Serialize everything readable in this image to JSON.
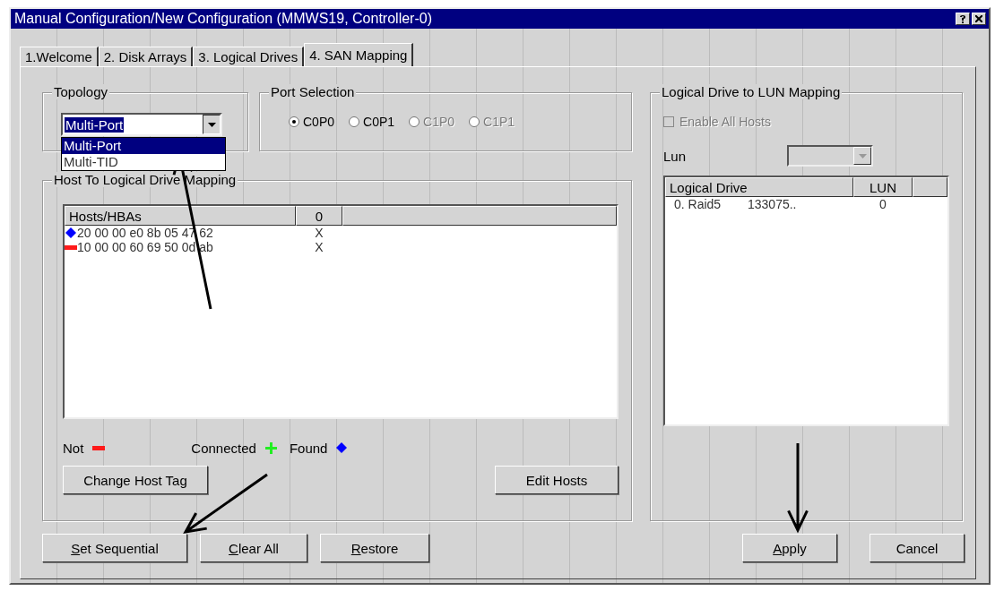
{
  "window": {
    "title": "Manual Configuration/New Configuration (MMWS19, Controller-0)"
  },
  "tabs": [
    {
      "label": "1.Welcome",
      "selected": false
    },
    {
      "label": "2. Disk Arrays",
      "selected": false
    },
    {
      "label": "3. Logical Drives",
      "selected": false
    },
    {
      "label": "4. SAN Mapping",
      "selected": true
    }
  ],
  "topology": {
    "label": "Topology",
    "value": "Multi-Port",
    "expanded": true,
    "options": [
      {
        "label": "Multi-Port",
        "selected": true
      },
      {
        "label": "Multi-TID",
        "selected": false
      }
    ]
  },
  "port_selection": {
    "label": "Port Selection",
    "options": [
      {
        "label": "C0P0",
        "selected": true,
        "disabled": false
      },
      {
        "label": "C0P1",
        "selected": false,
        "disabled": false
      },
      {
        "label": "C1P0",
        "selected": false,
        "disabled": true
      },
      {
        "label": "C1P1",
        "selected": false,
        "disabled": true
      }
    ]
  },
  "host_mapping": {
    "label": "Host To Logical Drive Mapping",
    "columns": [
      "Hosts/HBAs",
      "0"
    ],
    "rows": [
      {
        "kind": "found",
        "host": "20 00 00 e0 8b 05 47 62",
        "column_0": "X"
      },
      {
        "kind": "not",
        "host": "10 00 00 60 69 50 0d ab",
        "column_0": "X"
      }
    ],
    "legend": [
      {
        "label": "Not",
        "kind": "not"
      },
      {
        "label": "Connected",
        "kind": "connected"
      },
      {
        "label": "Found",
        "kind": "found"
      }
    ],
    "buttons": [
      {
        "label": "Change Host Tag",
        "mnemonic": false
      },
      {
        "label": "Edit Hosts",
        "mnemonic": false
      }
    ]
  },
  "lun_mapping": {
    "label": "Logical Drive to LUN Mapping",
    "enable_all_hosts": {
      "label": "Enable All Hosts",
      "checked": false,
      "disabled": true
    },
    "lun": {
      "label": "Lun",
      "disabled": true
    },
    "columns": [
      "Logical Drive",
      "LUN"
    ],
    "rows": [
      {
        "drive": "0. Raid5",
        "size": "133075..",
        "lun": "0"
      }
    ]
  },
  "left_buttons": [
    {
      "label": "Set Sequential",
      "mnemonic": true
    },
    {
      "label": "Clear All",
      "mnemonic": true
    },
    {
      "label": "Restore",
      "mnemonic": true
    }
  ],
  "right_buttons": [
    {
      "label": "Apply",
      "mnemonic": true
    },
    {
      "label": "Cancel",
      "mnemonic": false
    }
  ]
}
